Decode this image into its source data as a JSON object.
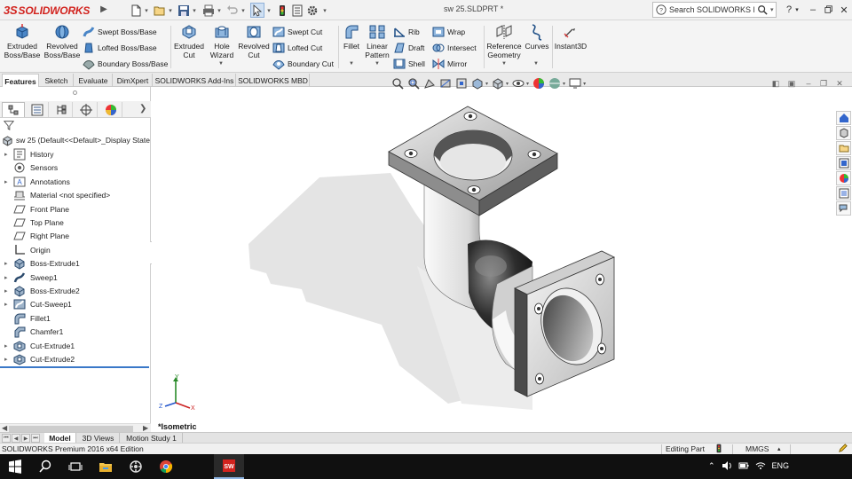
{
  "app": {
    "logo_text": "SOLIDWORKS",
    "logo_prefix": "3S",
    "document_title": "sw 25.SLDPRT *",
    "search_placeholder": "Search SOLIDWORKS Help",
    "brand_color": "#d2231e",
    "window_controls": [
      "help-icon",
      "minimize-icon",
      "restore-icon",
      "close-icon"
    ]
  },
  "quick_access": [
    "new-icon",
    "open-icon",
    "save-icon",
    "print-icon",
    "undo-icon",
    "select-icon",
    "rebuild-icon",
    "file-properties-icon",
    "options-icon"
  ],
  "ribbon": {
    "extruded_boss": "Extruded\nBoss/Base",
    "revolved_boss": "Revolved\nBoss/Base",
    "swept_boss": "Swept Boss/Base",
    "lofted_boss": "Lofted Boss/Base",
    "boundary_boss": "Boundary Boss/Base",
    "extruded_cut": "Extruded\nCut",
    "hole_wizard": "Hole\nWizard",
    "revolved_cut": "Revolved\nCut",
    "swept_cut": "Swept Cut",
    "lofted_cut": "Lofted Cut",
    "boundary_cut": "Boundary Cut",
    "fillet": "Fillet",
    "linear_pattern": "Linear\nPattern",
    "rib": "Rib",
    "draft": "Draft",
    "shell": "Shell",
    "wrap": "Wrap",
    "intersect": "Intersect",
    "mirror": "Mirror",
    "reference_geometry": "Reference\nGeometry",
    "curves": "Curves",
    "instant3d": "Instant3D"
  },
  "command_tabs": [
    "Features",
    "Sketch",
    "Evaluate",
    "DimXpert",
    "SOLIDWORKS Add-Ins",
    "SOLIDWORKS MBD"
  ],
  "active_command_tab": "Features",
  "feature_manager": {
    "panel_tabs": [
      "featuremanager-icon",
      "propertymanager-icon",
      "configurationmanager-icon",
      "dimxpert-icon",
      "display-manager-icon"
    ],
    "root": "sw 25  (Default<<Default>_Display State",
    "items": [
      {
        "label": "History",
        "icon": "history-icon",
        "expandable": true
      },
      {
        "label": "Sensors",
        "icon": "sensors-icon",
        "expandable": false
      },
      {
        "label": "Annotations",
        "icon": "annotations-icon",
        "expandable": true
      },
      {
        "label": "Material <not specified>",
        "icon": "material-icon",
        "expandable": false
      },
      {
        "label": "Front Plane",
        "icon": "plane-icon",
        "expandable": false
      },
      {
        "label": "Top Plane",
        "icon": "plane-icon",
        "expandable": false
      },
      {
        "label": "Right Plane",
        "icon": "plane-icon",
        "expandable": false
      },
      {
        "label": "Origin",
        "icon": "origin-icon",
        "expandable": false
      },
      {
        "label": "Boss-Extrude1",
        "icon": "boss-extrude-icon",
        "expandable": true
      },
      {
        "label": "Sweep1",
        "icon": "sweep-icon",
        "expandable": true
      },
      {
        "label": "Boss-Extrude2",
        "icon": "boss-extrude-icon",
        "expandable": true
      },
      {
        "label": "Cut-Sweep1",
        "icon": "cut-sweep-icon",
        "expandable": true
      },
      {
        "label": "Fillet1",
        "icon": "fillet-icon",
        "expandable": false
      },
      {
        "label": "Chamfer1",
        "icon": "chamfer-icon",
        "expandable": false
      },
      {
        "label": "Cut-Extrude1",
        "icon": "cut-extrude-icon",
        "expandable": true
      },
      {
        "label": "Cut-Extrude2",
        "icon": "cut-extrude-icon",
        "expandable": true
      }
    ]
  },
  "graphics": {
    "view_label": "*Isometric",
    "triad": {
      "x": "X",
      "y": "Y",
      "z": "Z"
    }
  },
  "bottom_tabs": [
    "Model",
    "3D Views",
    "Motion Study 1"
  ],
  "active_bottom_tab": "Model",
  "status": {
    "edition": "SOLIDWORKS Premium 2016 x64 Edition",
    "editing": "Editing Part",
    "units": "MMGS"
  },
  "taskbar": {
    "apps": [
      "windows-start-icon",
      "search-icon",
      "task-view-icon",
      "file-explorer-icon",
      "app-icon",
      "chrome-icon",
      "solidworks-icon"
    ],
    "language": "ENG"
  }
}
